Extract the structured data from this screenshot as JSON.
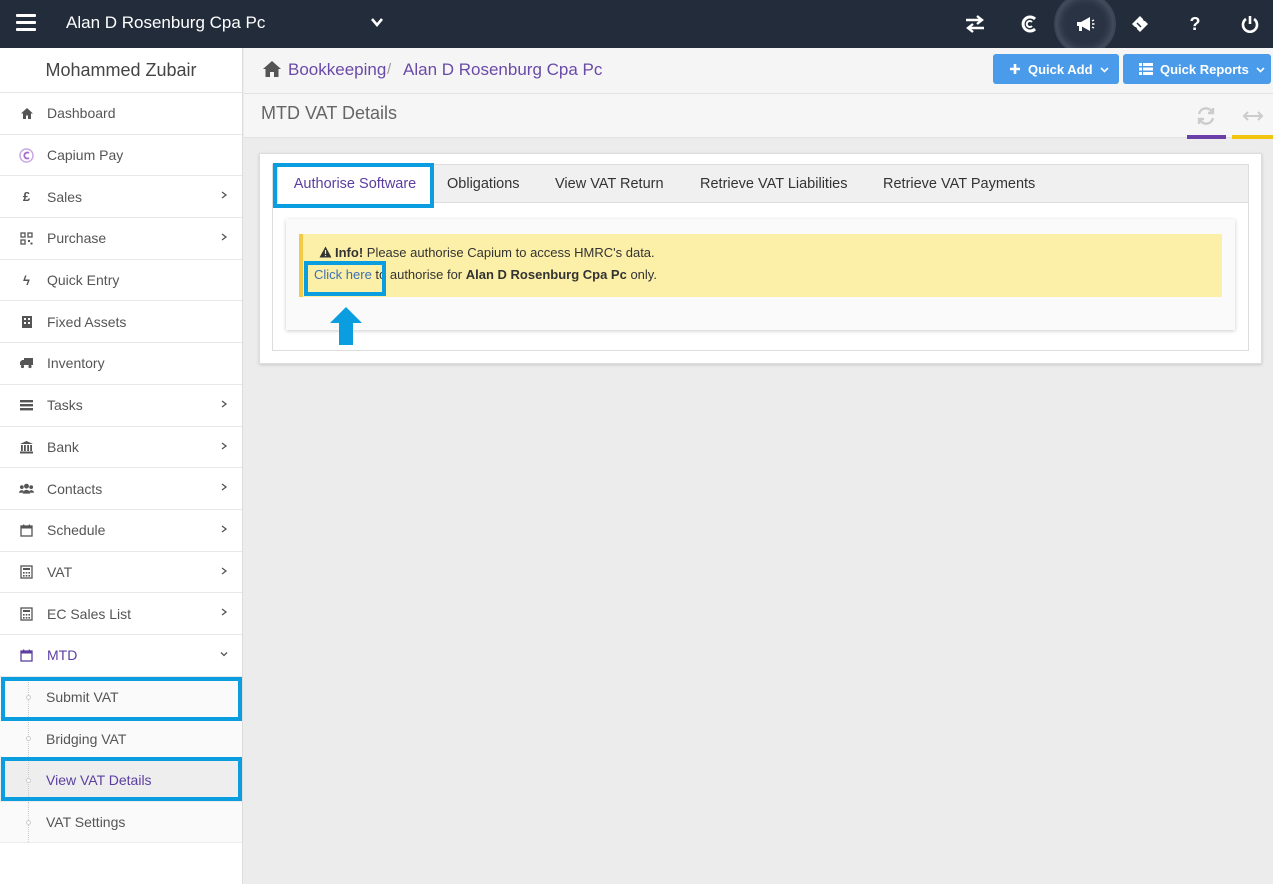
{
  "topbar": {
    "company": "Alan D Rosenburg Cpa Pc",
    "icons": [
      "menu-icon",
      "chevron-down-icon",
      "switch-icon",
      "capium-icon",
      "megaphone-icon",
      "ticket-icon",
      "help-icon",
      "power-icon"
    ],
    "help_glyph": "?"
  },
  "sidebar": {
    "user": "Mohammed Zubair",
    "items": [
      {
        "label": "Dashboard",
        "icon": "home-icon",
        "chevron": false
      },
      {
        "label": "Capium Pay",
        "icon": "capium-pay-icon",
        "chevron": false
      },
      {
        "label": "Sales",
        "icon": "pound-icon",
        "chevron": true
      },
      {
        "label": "Purchase",
        "icon": "qrcode-icon",
        "chevron": true
      },
      {
        "label": "Quick Entry",
        "icon": "bolt-icon",
        "chevron": false
      },
      {
        "label": "Fixed Assets",
        "icon": "building-icon",
        "chevron": false
      },
      {
        "label": "Inventory",
        "icon": "truck-icon",
        "chevron": false
      },
      {
        "label": "Tasks",
        "icon": "tasks-icon",
        "chevron": true
      },
      {
        "label": "Bank",
        "icon": "bank-icon",
        "chevron": true
      },
      {
        "label": "Contacts",
        "icon": "users-icon",
        "chevron": true
      },
      {
        "label": "Schedule",
        "icon": "calendar-icon",
        "chevron": true
      },
      {
        "label": "VAT",
        "icon": "calculator-icon",
        "chevron": true
      },
      {
        "label": "EC Sales List",
        "icon": "calculator-icon",
        "chevron": true
      },
      {
        "label": "MTD",
        "icon": "calendar-icon",
        "chevron": "down"
      }
    ],
    "pound_glyph": "£",
    "bolt_glyph": "ϟ",
    "sub_items": [
      {
        "label": "Submit VAT"
      },
      {
        "label": "Bridging VAT"
      },
      {
        "label": "View VAT Details"
      },
      {
        "label": "VAT Settings"
      }
    ]
  },
  "breadcrumb": {
    "items": [
      "Bookkeeping",
      "Alan D Rosenburg Cpa Pc"
    ],
    "separator": "/"
  },
  "quick_buttons": {
    "add": "Quick Add",
    "reports": "Quick Reports"
  },
  "page": {
    "title": "MTD VAT Details"
  },
  "tabs": [
    "Authorise Software",
    "Obligations",
    "View VAT Return",
    "Retrieve VAT Liabilities",
    "Retrieve VAT Payments"
  ],
  "alert": {
    "strong": "Info!",
    "line1": " Please authorise Capium to access HMRC's data.",
    "link": "Click here",
    "line2_mid": " to authorise for ",
    "company": "Alan D Rosenburg Cpa Pc",
    "line2_end": " only."
  },
  "colors": {
    "topbar": "#232c3b",
    "accent_purple": "#5b3ea0",
    "button_blue": "#4a9bea",
    "highlight_blue": "#0a9de0",
    "alert_bg": "#fcf0a8"
  }
}
